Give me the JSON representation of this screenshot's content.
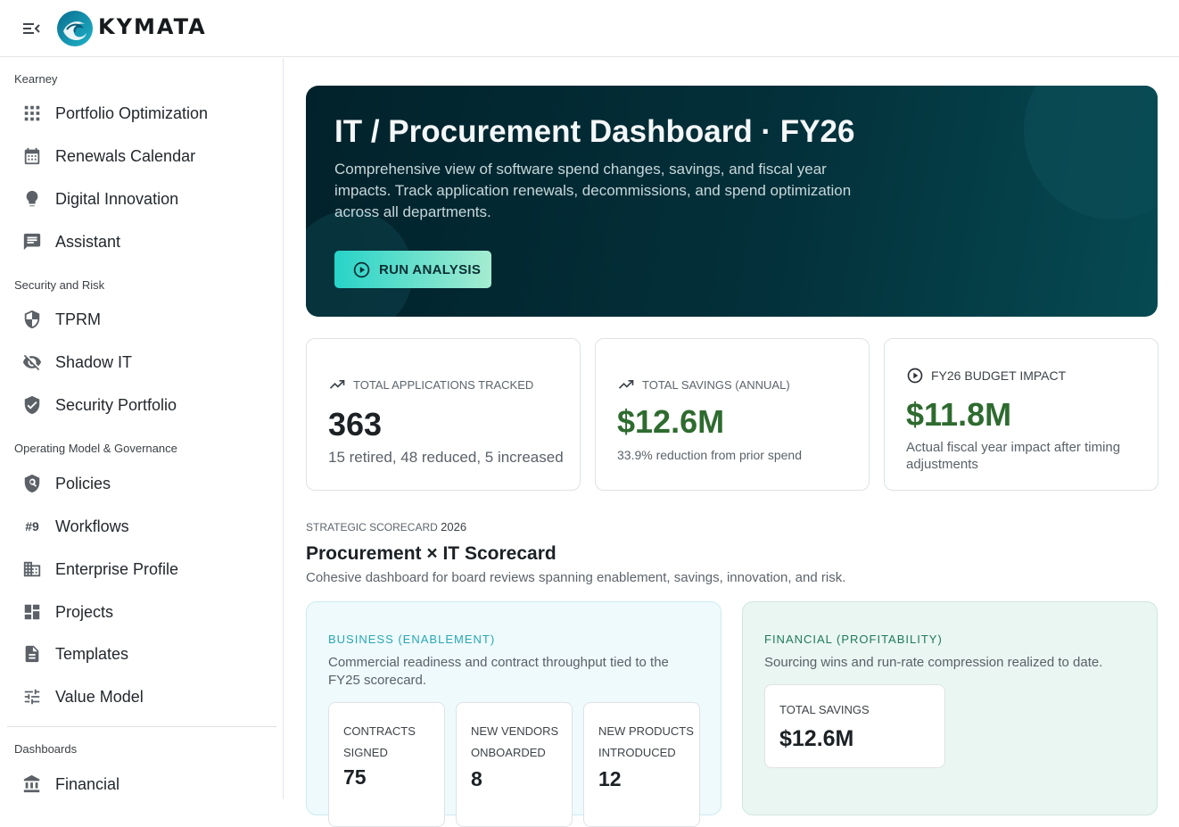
{
  "app": {
    "brand": "KYMATA"
  },
  "sidebar": {
    "sections": [
      {
        "label": "Kearney",
        "items": [
          {
            "label": "Portfolio Optimization",
            "icon": "grid-icon"
          },
          {
            "label": "Renewals Calendar",
            "icon": "calendar-icon"
          },
          {
            "label": "Digital Innovation",
            "icon": "lightbulb-icon"
          },
          {
            "label": "Assistant",
            "icon": "chat-icon"
          }
        ]
      },
      {
        "label": "Security and Risk",
        "items": [
          {
            "label": "TPRM",
            "icon": "shield-half-icon"
          },
          {
            "label": "Shadow IT",
            "icon": "eye-off-icon"
          },
          {
            "label": "Security Portfolio",
            "icon": "shield-check-icon"
          }
        ]
      },
      {
        "label": "Operating Model & Governance",
        "items": [
          {
            "label": "Policies",
            "icon": "policy-icon"
          },
          {
            "label": "Workflows",
            "icon": "hash-icon",
            "glyph": "#9"
          },
          {
            "label": "Enterprise Profile",
            "icon": "building-icon"
          },
          {
            "label": "Projects",
            "icon": "dashboard-icon"
          },
          {
            "label": "Templates",
            "icon": "document-icon"
          },
          {
            "label": "Value Model",
            "icon": "tune-icon"
          }
        ]
      },
      {
        "label": "Dashboards",
        "items": [
          {
            "label": "Financial",
            "icon": "bank-icon"
          }
        ]
      }
    ]
  },
  "hero": {
    "title": "IT / Procurement Dashboard · FY26",
    "subtitle": "Comprehensive view of software spend changes, savings, and fiscal year impacts. Track application renewals, decommissions, and spend optimization across all departments.",
    "button_label": "RUN ANALYSIS"
  },
  "kpis": [
    {
      "label": "TOTAL APPLICATIONS TRACKED",
      "value": "363",
      "note": "15 retired, 48 reduced, 5 increased",
      "value_color": "#1c2125"
    },
    {
      "label": "TOTAL SAVINGS (ANNUAL)",
      "value": "$12.6M",
      "note": "33.9% reduction from prior spend",
      "value_color": "#2e6b2f"
    },
    {
      "label": "FY26 BUDGET IMPACT",
      "value": "$11.8M",
      "note": "Actual fiscal year impact after timing adjustments",
      "value_color": "#2e6b2f"
    }
  ],
  "scorecard": {
    "eyebrow": "STRATEGIC SCORECARD",
    "year": "2026",
    "title": "Procurement × IT Scorecard",
    "subtitle": "Cohesive dashboard for board reviews spanning enablement, savings, innovation, and risk.",
    "business": {
      "tag": "BUSINESS (ENABLEMENT)",
      "description": "Commercial readiness and contract throughput tied to the FY25 scorecard.",
      "metrics": [
        {
          "label": "CONTRACTS SIGNED",
          "value": "75"
        },
        {
          "label": "NEW VENDORS ONBOARDED",
          "value": "8"
        },
        {
          "label": "NEW PRODUCTS INTRODUCED",
          "value": "12"
        }
      ]
    },
    "financial": {
      "tag": "FINANCIAL (PROFITABILITY)",
      "description": "Sourcing wins and run-rate compression realized to date.",
      "metrics": [
        {
          "label": "TOTAL SAVINGS",
          "value": "$12.6M"
        }
      ]
    }
  },
  "colors": {
    "accent": "#27d3c8",
    "hero_bg": "#02222b",
    "positive": "#2e6b2f"
  }
}
